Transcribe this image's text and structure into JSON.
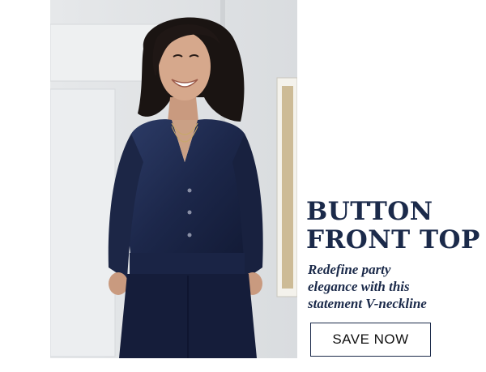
{
  "promo": {
    "headline_lines": [
      "BUTTON",
      "FRONT TOP"
    ],
    "subcopy_lines": [
      "Redefine party",
      "elegance with this",
      "statement V-neckline"
    ],
    "cta_label": "SAVE NOW"
  },
  "colors": {
    "navy": "#1b2a4a",
    "background": "#ffffff",
    "velvet": "#1f2b4d"
  }
}
